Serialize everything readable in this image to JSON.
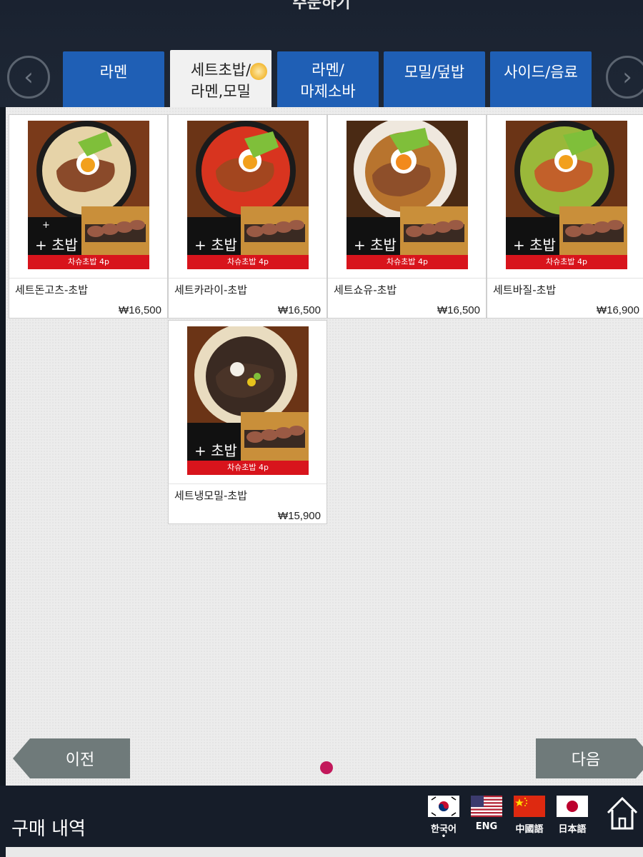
{
  "header": {
    "title": "주문하기"
  },
  "tabs": [
    {
      "label": "라멘"
    },
    {
      "label": "세트초밥/\n라멘,모밀",
      "active": true
    },
    {
      "label": "라멘/\n마제소바"
    },
    {
      "label": "모밀/덮밥"
    },
    {
      "label": "사이드/음료"
    }
  ],
  "menu_items": [
    {
      "name": "세트돈고츠-초밥",
      "price": "₩16,500",
      "badge": "+ 초밥",
      "banner": "차슈초밥 4p",
      "broth_color": "#e6d3a8"
    },
    {
      "name": "세트카라이-초밥",
      "price": "₩16,500",
      "badge": "+ 초밥",
      "banner": "차슈초밥 4p",
      "broth_color": "#d8341f"
    },
    {
      "name": "세트쇼유-초밥",
      "price": "₩16,500",
      "badge": "+ 초밥",
      "banner": "차슈초밥 4p",
      "broth_color": "#b8742e"
    },
    {
      "name": "세트바질-초밥",
      "price": "₩16,900",
      "badge": "+ 초밥",
      "banner": "차슈초밥 4p",
      "broth_color": "#9ab83a"
    },
    {
      "name": "세트냉모밀-초밥",
      "price": "₩15,900",
      "badge": "+ 초밥",
      "banner": "차슈초밥 4p",
      "broth_color": "#3a2a22"
    }
  ],
  "pager": {
    "prev_label": "이전",
    "next_label": "다음",
    "current_page": 1,
    "page_count": 1
  },
  "footer": {
    "purchase_label": "구매 내역",
    "languages": [
      {
        "code": "ko",
        "label": "한국어",
        "selected": true
      },
      {
        "code": "en",
        "label": "ENG"
      },
      {
        "code": "zh",
        "label": "中國語"
      },
      {
        "code": "ja",
        "label": "日本語"
      }
    ]
  },
  "colors": {
    "tab_blue": "#1f5fb5",
    "page_dot": "#c2185b",
    "banner_red": "#d8141c",
    "pager_gray": "#6f7a7a"
  }
}
